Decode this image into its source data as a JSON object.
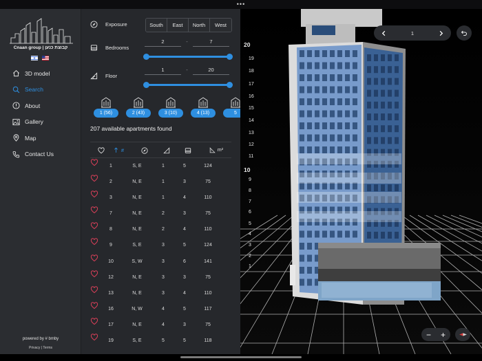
{
  "brand": {
    "name": "Cnaan group | קבוצת כנען",
    "flags": [
      "israel-flag-icon",
      "usa-flag-icon"
    ]
  },
  "nav": [
    {
      "label": "3D model",
      "icon": "home-icon"
    },
    {
      "label": "Search",
      "icon": "search-icon",
      "active": true
    },
    {
      "label": "About",
      "icon": "info-icon"
    },
    {
      "label": "Gallery",
      "icon": "image-icon"
    },
    {
      "label": "Map",
      "icon": "map-pin-icon"
    },
    {
      "label": "Contact Us",
      "icon": "phone-icon"
    }
  ],
  "footer": {
    "powered": "powered by # bmby",
    "legal": "Privacy | Terms"
  },
  "filters": {
    "exposure": {
      "label": "Exposure",
      "options": [
        "South",
        "East",
        "North",
        "West"
      ]
    },
    "bedrooms": {
      "label": "Bedrooms",
      "min": "2",
      "max": "7",
      "sep": "-"
    },
    "floor": {
      "label": "Floor",
      "min": "1",
      "max": "20",
      "sep": "-"
    }
  },
  "room_types": [
    {
      "label": "1 (56)"
    },
    {
      "label": "2 (43)"
    },
    {
      "label": "3 (10)"
    },
    {
      "label": "4 (13)"
    },
    {
      "label": "5"
    }
  ],
  "results": {
    "count_text": "207 available apartments found"
  },
  "table": {
    "headers": {
      "num": "#",
      "area": "m²"
    },
    "rows": [
      [
        "1",
        "S, E",
        "1",
        "5",
        "124"
      ],
      [
        "2",
        "N, E",
        "1",
        "3",
        "75"
      ],
      [
        "3",
        "N, E",
        "1",
        "4",
        "110"
      ],
      [
        "7",
        "N, E",
        "2",
        "3",
        "75"
      ],
      [
        "8",
        "N, E",
        "2",
        "4",
        "110"
      ],
      [
        "9",
        "S, E",
        "3",
        "5",
        "124"
      ],
      [
        "10",
        "S, W",
        "3",
        "6",
        "141"
      ],
      [
        "12",
        "N, E",
        "3",
        "3",
        "75"
      ],
      [
        "13",
        "N, E",
        "3",
        "4",
        "110"
      ],
      [
        "16",
        "N, W",
        "4",
        "5",
        "117"
      ],
      [
        "17",
        "N, E",
        "4",
        "3",
        "75"
      ],
      [
        "19",
        "S, E",
        "5",
        "5",
        "118"
      ]
    ]
  },
  "viewer": {
    "floors": [
      "20",
      "19",
      "18",
      "17",
      "16",
      "15",
      "14",
      "13",
      "12",
      "11",
      "10",
      "9",
      "8",
      "7",
      "6",
      "5",
      "4",
      "3",
      "2",
      "1"
    ],
    "page": "1",
    "zoom_out": "−",
    "zoom_in": "+"
  },
  "colors": {
    "accent": "#2e8fe0",
    "sidebar": "#2b2d31",
    "panel": "#26282c"
  }
}
